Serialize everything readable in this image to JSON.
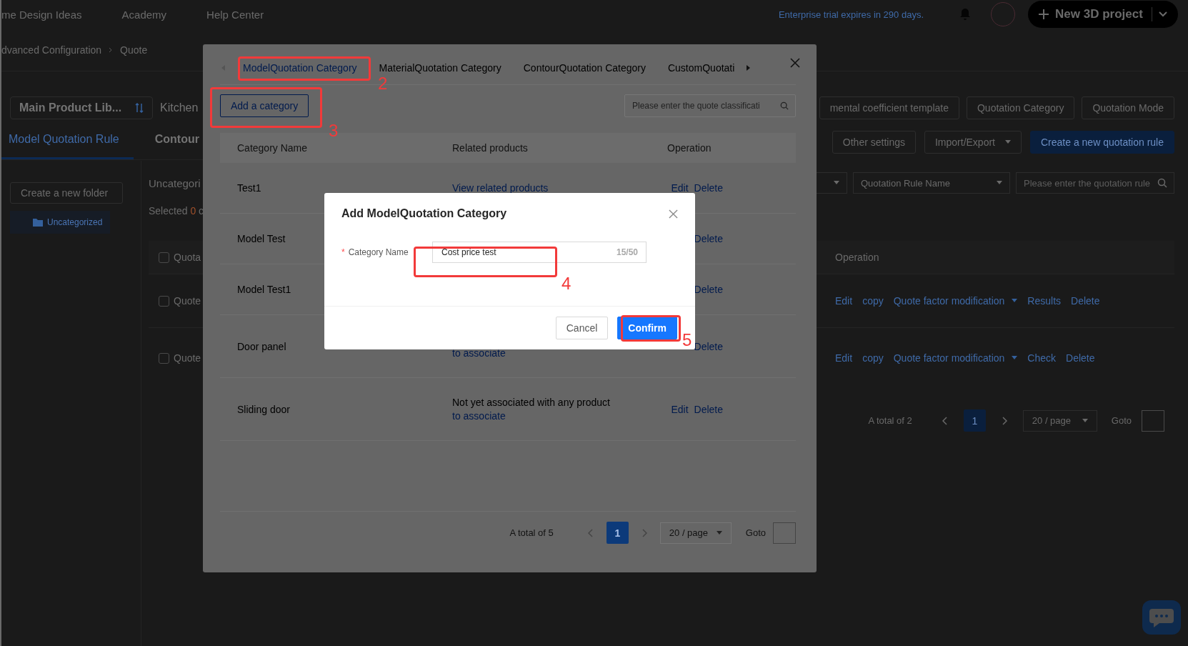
{
  "top_nav": {
    "links": [
      "me Design Ideas",
      "Academy",
      "Help Center"
    ],
    "trial_notice": "Enterprise trial expires in 290 days.",
    "new_project_button": "New 3D project"
  },
  "breadcrumb": [
    "dvanced Configuration",
    "Quote"
  ],
  "library_select": "Main Product Lib...",
  "library_tabs": [
    "Kitchen"
  ],
  "header_buttons": [
    "mental coefficient template",
    "Quotation Category",
    "Quotation Mode"
  ],
  "rule_tabs": [
    {
      "label": "Model Quotation Rule",
      "selected": true
    },
    {
      "label": "Contour",
      "selected": false
    }
  ],
  "toolbar_buttons": [
    {
      "label": "Other settings",
      "kind": "plain"
    },
    {
      "label": "Import/Export",
      "kind": "dropdown"
    },
    {
      "label": "Create a new quotation rule",
      "kind": "primary"
    }
  ],
  "sidebar": {
    "new_folder_button": "Create a new folder",
    "folders": [
      {
        "label": "Uncategorized",
        "selected": true
      }
    ]
  },
  "folder_title": "Uncategori",
  "selected_note": {
    "prefix": "Selected",
    "count": "0",
    "suffix": "c"
  },
  "filters": {
    "rule_name_select": "Quotation Rule Name",
    "search_placeholder": "Please enter the quotation rule"
  },
  "rules_table": {
    "columns": [
      "Quota",
      "Operation"
    ],
    "all_checked": false,
    "rows": [
      {
        "name": "Quote",
        "checked": false,
        "actions": [
          {
            "label": "Edit",
            "kind": "link"
          },
          {
            "label": "copy",
            "kind": "link"
          },
          {
            "label": "Quote factor modification",
            "kind": "dropdown"
          },
          {
            "label": "Results",
            "kind": "link"
          },
          {
            "label": "Delete",
            "kind": "link"
          }
        ]
      },
      {
        "name": "Quote",
        "checked": false,
        "actions": [
          {
            "label": "Edit",
            "kind": "link"
          },
          {
            "label": "copy",
            "kind": "link"
          },
          {
            "label": "Quote factor modification",
            "kind": "dropdown"
          },
          {
            "label": "Check",
            "kind": "link"
          },
          {
            "label": "Delete",
            "kind": "link"
          }
        ]
      }
    ]
  },
  "rules_pagination": {
    "total": "A total of 2",
    "pages": [
      {
        "label": "1",
        "selected": true
      }
    ],
    "page_size": "20 / page",
    "goto": "Goto"
  },
  "category_modal": {
    "tabs": [
      {
        "label": "ModelQuotation Category",
        "selected": true
      },
      {
        "label": "MaterialQuotation Category",
        "selected": false
      },
      {
        "label": "ContourQuotation Category",
        "selected": false
      },
      {
        "label": "CustomQuotati",
        "selected": false
      }
    ],
    "add_button": "Add a category",
    "search_placeholder": "Please enter the quote classificati",
    "columns": [
      "Category Name",
      "Related products",
      "Operation"
    ],
    "rows": [
      {
        "name": "Test1",
        "related": {
          "kind": "link",
          "link": "View related products"
        },
        "actions": [
          "Edit",
          "Delete"
        ]
      },
      {
        "name": "Model Test",
        "actions": [
          "Delete"
        ]
      },
      {
        "name": "Model Test1",
        "actions": [
          "Delete"
        ]
      },
      {
        "name": "Door panel",
        "related": {
          "kind": "note",
          "link": "to associate"
        },
        "actions": [
          "Delete"
        ]
      },
      {
        "name": "Sliding door",
        "related": {
          "kind": "note",
          "note": "Not yet associated with any product",
          "link": "to associate"
        },
        "actions": [
          "Edit",
          "Delete"
        ]
      }
    ],
    "pagination": {
      "total": "A total of 5",
      "pages": [
        {
          "label": "1",
          "selected": true
        }
      ],
      "page_size": "20 / page",
      "goto": "Goto"
    }
  },
  "dialog": {
    "title": "Add ModelQuotation Category",
    "field": {
      "required_mark": "*",
      "label": "Category Name",
      "value": "Cost price test",
      "counter": "15/50"
    },
    "buttons": [
      {
        "label": "Cancel",
        "kind": "default"
      },
      {
        "label": "Confirm",
        "kind": "primary"
      }
    ]
  },
  "annotations": [
    "2",
    "3",
    "4",
    "5"
  ]
}
